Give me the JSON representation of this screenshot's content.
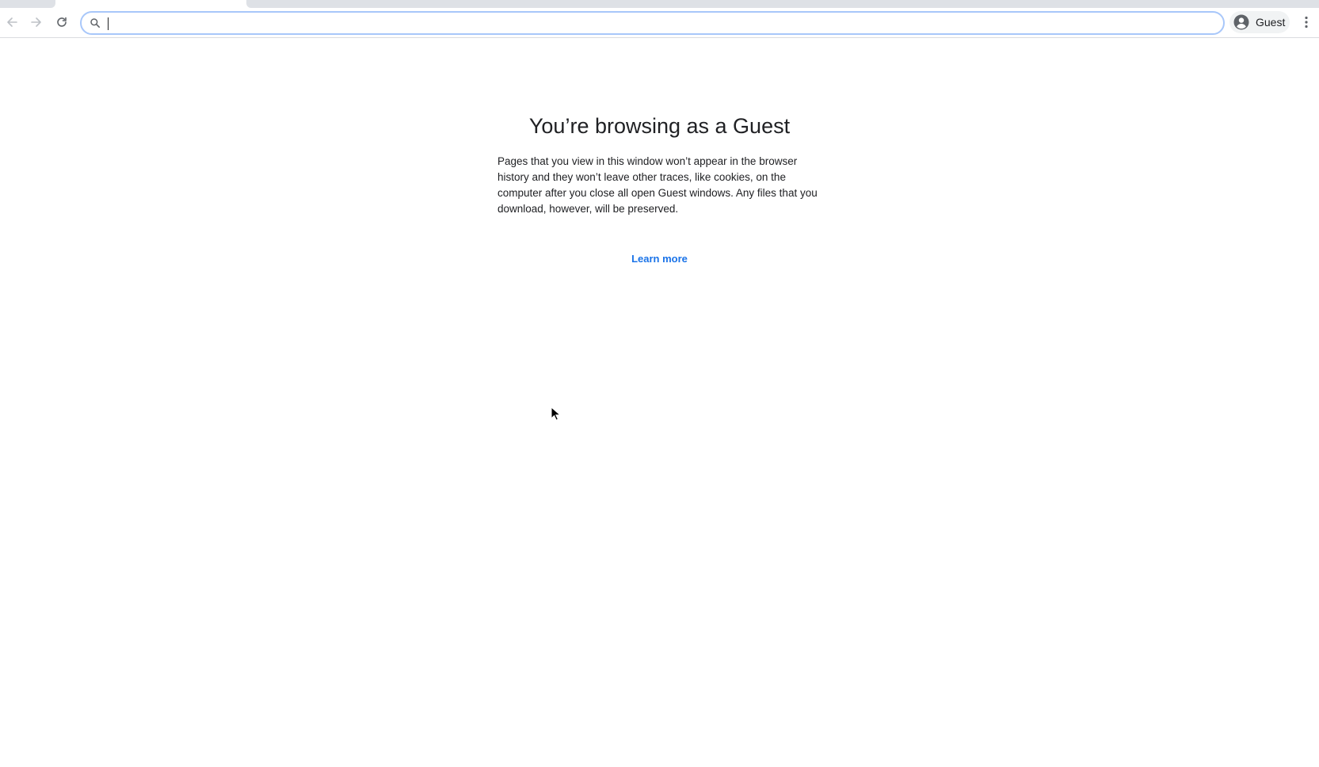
{
  "browser": {
    "profile_label": "Guest",
    "omnibox": {
      "value": "",
      "placeholder": ""
    },
    "icons": {
      "back": "arrow-left-icon",
      "forward": "arrow-right-icon",
      "reload": "reload-icon",
      "search": "search-icon",
      "avatar": "avatar-icon",
      "menu": "kebab-menu-icon"
    },
    "colors": {
      "omnibox_border": "#a8c7fa",
      "link": "#1a73e8",
      "tabstrip": "#dee1e6"
    }
  },
  "page": {
    "title": "You’re browsing as a Guest",
    "description": "Pages that you view in this window won’t appear in the browser history and they won’t leave other traces, like cookies, on the computer after you close all open Guest windows. Any files that you download, however, will be preserved.",
    "learn_more": "Learn more"
  }
}
